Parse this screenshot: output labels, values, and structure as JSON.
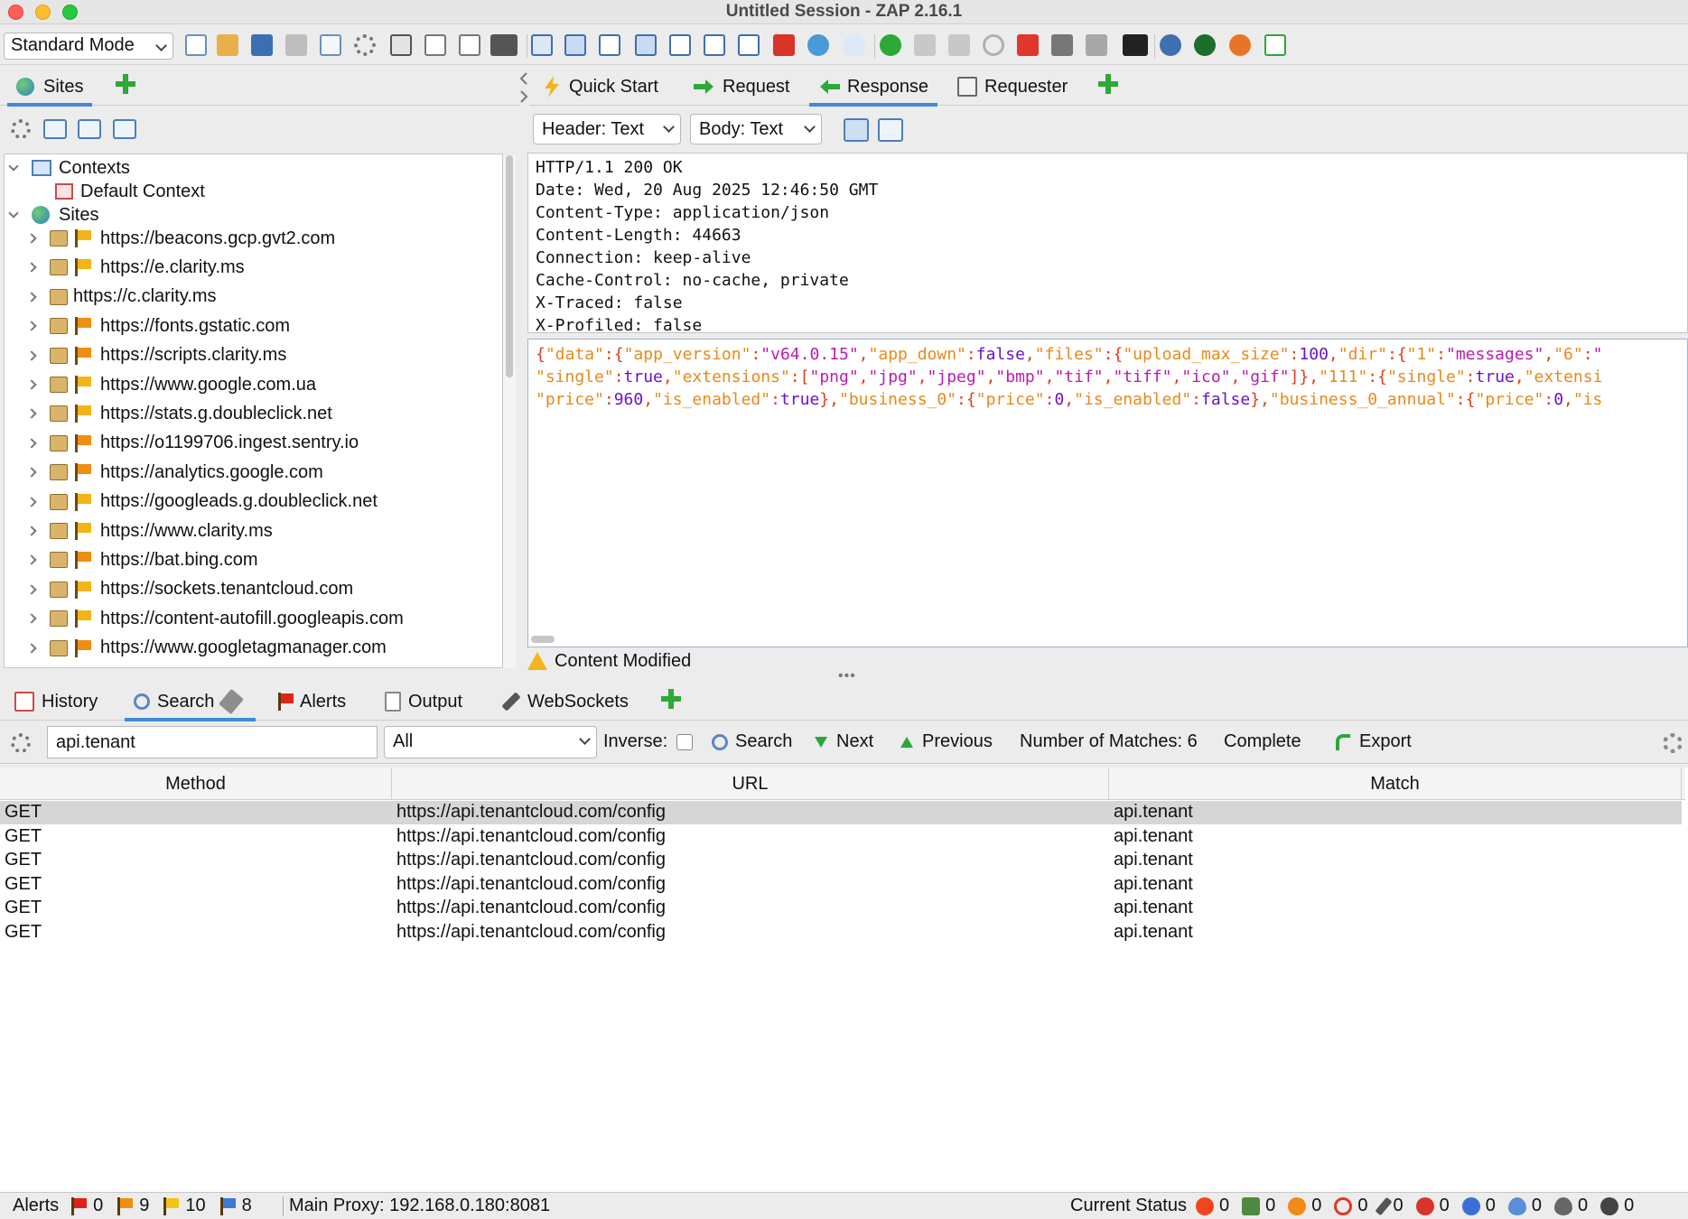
{
  "window": {
    "title": "Untitled Session - ZAP 2.16.1"
  },
  "toolbar": {
    "mode": "Standard Mode"
  },
  "sites_tabs": {
    "sites": "Sites"
  },
  "sites_tree": {
    "contexts_label": "Contexts",
    "default_context": "Default Context",
    "sites_label": "Sites",
    "sites": [
      {
        "url": "https://beacons.gcp.gvt2.com",
        "flag": "yellow"
      },
      {
        "url": "https://e.clarity.ms",
        "flag": "yellow"
      },
      {
        "url": "https://c.clarity.ms",
        "flag": "none"
      },
      {
        "url": "https://fonts.gstatic.com",
        "flag": "orange"
      },
      {
        "url": "https://scripts.clarity.ms",
        "flag": "orange"
      },
      {
        "url": "https://www.google.com.ua",
        "flag": "yellow"
      },
      {
        "url": "https://stats.g.doubleclick.net",
        "flag": "yellow"
      },
      {
        "url": "https://o1199706.ingest.sentry.io",
        "flag": "orange"
      },
      {
        "url": "https://analytics.google.com",
        "flag": "orange"
      },
      {
        "url": "https://googleads.g.doubleclick.net",
        "flag": "yellow"
      },
      {
        "url": "https://www.clarity.ms",
        "flag": "yellow"
      },
      {
        "url": "https://bat.bing.com",
        "flag": "orange"
      },
      {
        "url": "https://sockets.tenantcloud.com",
        "flag": "yellow"
      },
      {
        "url": "https://content-autofill.googleapis.com",
        "flag": "yellow"
      },
      {
        "url": "https://www.googletagmanager.com",
        "flag": "orange"
      }
    ]
  },
  "work_tabs": {
    "quick_start": "Quick Start",
    "request": "Request",
    "response": "Response",
    "requester": "Requester"
  },
  "response_view": {
    "header_format": "Header: Text",
    "body_format": "Body: Text",
    "header_lines": [
      "HTTP/1.1 200 OK",
      "Date: Wed, 20 Aug 2025 12:46:50 GMT",
      "Content-Type: application/json",
      "Content-Length: 44663",
      "Connection: keep-alive",
      "Cache-Control: no-cache, private",
      "X-Traced: false",
      "X-Profiled: false"
    ],
    "content_modified": "Content Modified"
  },
  "bottom_tabs": {
    "history": "History",
    "search": "Search",
    "alerts": "Alerts",
    "output": "Output",
    "websockets": "WebSockets"
  },
  "search": {
    "query": "api.tenant",
    "scope": "All",
    "inverse_label": "Inverse:",
    "search_button": "Search",
    "next_button": "Next",
    "previous_button": "Previous",
    "matches_text": "Number of Matches: 6",
    "complete_text": "Complete",
    "export_button": "Export"
  },
  "results": {
    "columns": [
      "Method",
      "URL",
      "Match"
    ],
    "rows": [
      [
        "GET",
        "https://api.tenantcloud.com/config",
        "api.tenant"
      ],
      [
        "GET",
        "https://api.tenantcloud.com/config",
        "api.tenant"
      ],
      [
        "GET",
        "https://api.tenantcloud.com/config",
        "api.tenant"
      ],
      [
        "GET",
        "https://api.tenantcloud.com/config",
        "api.tenant"
      ],
      [
        "GET",
        "https://api.tenantcloud.com/config",
        "api.tenant"
      ],
      [
        "GET",
        "https://api.tenantcloud.com/config",
        "api.tenant"
      ]
    ]
  },
  "statusbar": {
    "alerts_label": "Alerts",
    "alert_counts": [
      "0",
      "9",
      "10",
      "8"
    ],
    "proxy": "Main Proxy: 192.168.0.180:8081",
    "current_status_label": "Current Status",
    "status_counts": [
      "0",
      "0",
      "0",
      "0",
      "0",
      "0",
      "0",
      "0",
      "0",
      "0"
    ]
  },
  "colors": {
    "accent": "#3f8ad6",
    "flag_yellow": "#f3b418",
    "flag_orange": "#f08d13"
  }
}
